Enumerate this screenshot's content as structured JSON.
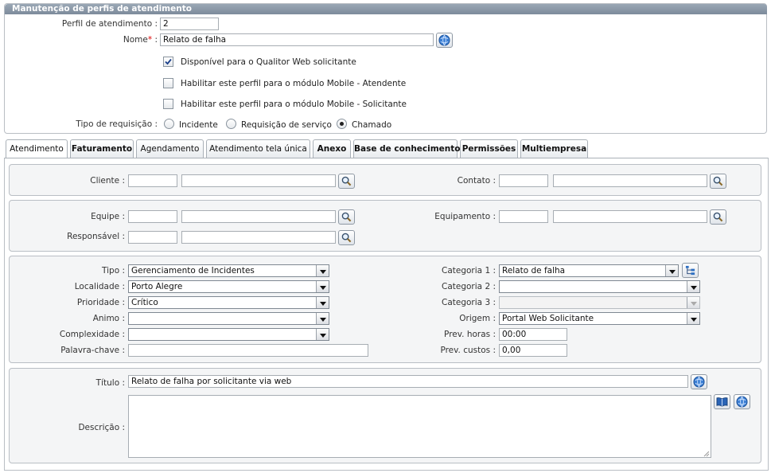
{
  "header": {
    "title": "Manutenção de perfis de atendimento"
  },
  "top": {
    "perfil_label": "Perfil de atendimento :",
    "perfil_value": "2",
    "nome_label": "Nome",
    "nome_req": "*",
    "nome_colon": ":",
    "nome_value": "Relato de falha",
    "checkboxes": [
      {
        "label": "Disponível para o Qualitor Web solicitante",
        "checked": true
      },
      {
        "label": "Habilitar este perfil para o módulo Mobile - Atendente",
        "checked": false
      },
      {
        "label": "Habilitar este perfil para o módulo Mobile - Solicitante",
        "checked": false
      }
    ],
    "tipo_label": "Tipo de requisição :",
    "radios": [
      {
        "label": "Incidente",
        "checked": false
      },
      {
        "label": "Requisição de serviço",
        "checked": false
      },
      {
        "label": "Chamado",
        "checked": true
      }
    ]
  },
  "tabs": [
    {
      "label": "Atendimento"
    },
    {
      "label": "Faturamento"
    },
    {
      "label": "Agendamento"
    },
    {
      "label": "Atendimento tela única"
    },
    {
      "label": "Anexo"
    },
    {
      "label": "Base de conhecimento"
    },
    {
      "label": "Permissões"
    },
    {
      "label": "Multiempresa"
    }
  ],
  "section1": {
    "cliente_label": "Cliente :",
    "cliente_code": "",
    "cliente_name": "",
    "contato_label": "Contato :",
    "contato_code": "",
    "contato_name": ""
  },
  "section2": {
    "equipe_label": "Equipe :",
    "equipamento_label": "Equipamento :",
    "responsavel_label": "Responsável :"
  },
  "section3": {
    "tipo_label": "Tipo :",
    "tipo_value": "Gerenciamento de Incidentes",
    "localidade_label": "Localidade :",
    "localidade_value": "Porto Alegre",
    "prioridade_label": "Prioridade :",
    "prioridade_value": "Crítico",
    "animo_label": "Animo :",
    "animo_value": "",
    "complexidade_label": "Complexidade :",
    "complexidade_value": "",
    "palavra_label": "Palavra-chave :",
    "palavra_value": "",
    "cat1_label": "Categoria 1 :",
    "cat1_value": "Relato de falha",
    "cat2_label": "Categoria 2 :",
    "cat2_value": "",
    "cat3_label": "Categoria 3 :",
    "cat3_value": "",
    "origem_label": "Origem :",
    "origem_value": "Portal Web Solicitante",
    "prevhoras_label": "Prev. horas :",
    "prevhoras_value": "00:00",
    "prevcustos_label": "Prev. custos :",
    "prevcustos_value": "0,00"
  },
  "section4": {
    "titulo_label": "Título :",
    "titulo_value": "Relato de falha por solicitante via web",
    "descricao_label": "Descrição :",
    "descricao_value": ""
  },
  "colors": {
    "titlebar": "#8b98a7",
    "required": "#dd0000",
    "panel_bg": "#f4f5f6"
  }
}
